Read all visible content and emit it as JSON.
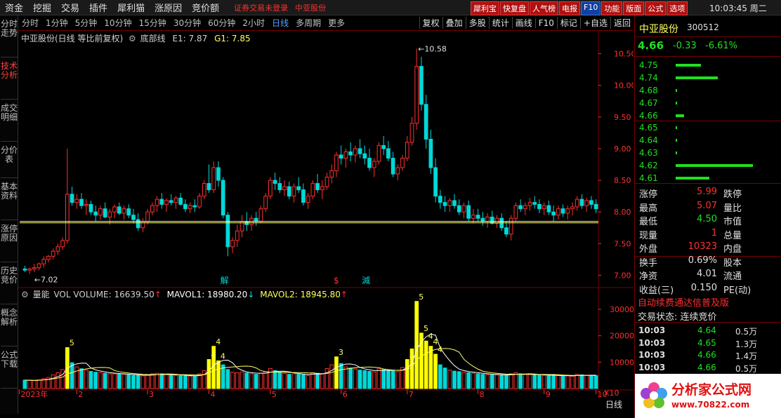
{
  "menu": [
    "资金",
    "挖掘",
    "交易",
    "插件",
    "犀利猫",
    "涨原因",
    "竞价额"
  ],
  "alert_login": "证券交易未登录",
  "alert_stock": "中亚股份",
  "top_buttons": [
    "犀利宝",
    "快复盘",
    "人气榜",
    "电报",
    "F10",
    "功能",
    "版面",
    "公式",
    "选项"
  ],
  "clock": "10:03:45 周二",
  "side_tabs": [
    "分时走势",
    "技术分析",
    "成交明细",
    "分价表",
    "基本资料",
    "涨停原因",
    "历史竞价",
    "概念解析",
    "公式下载"
  ],
  "periods": [
    "分时",
    "1分钟",
    "5分钟",
    "10分钟",
    "15分钟",
    "30分钟",
    "60分钟",
    "2小时",
    "日线",
    "多周期",
    "更多"
  ],
  "tools": [
    "复权",
    "叠加",
    "多股",
    "统计",
    "画线",
    "F10",
    "标记",
    "+自选",
    "返回"
  ],
  "chart_header": {
    "title": "中亚股份(日线 等比前复权)",
    "indicator": "底部线",
    "e1": "E1: 7.87",
    "g1": "G1: 7.85"
  },
  "volume_header": {
    "name": "量能",
    "vol": "VOL VOLUME: 16639.50",
    "mavol1": "MAVOL1: 18980.20",
    "mavol2": "MAVOL2: 18945.80"
  },
  "annotations": {
    "low": "7.02",
    "high": "10.58",
    "marks": [
      "解",
      "$",
      "減"
    ]
  },
  "stock": {
    "name": "中亚股份",
    "code": "300512",
    "price": "4.66",
    "change": "-0.33",
    "pct": "-6.61%"
  },
  "orderbook": [
    {
      "price": "4.75",
      "size": 0.18
    },
    {
      "price": "4.74",
      "size": 0.3
    },
    {
      "price": "4.68",
      "size": 0.01
    },
    {
      "price": "4.67",
      "size": 0.01
    },
    {
      "price": "4.66",
      "size": 0.06
    },
    {
      "price": "4.65",
      "size": 0.01
    },
    {
      "price": "4.64",
      "size": 0.01
    },
    {
      "price": "4.63",
      "size": 0.01
    },
    {
      "price": "4.62",
      "size": 0.55
    },
    {
      "price": "4.61",
      "size": 0.24
    }
  ],
  "stats": [
    {
      "l": "涨停",
      "v": "5.99",
      "r": "跌停",
      "color": "red"
    },
    {
      "l": "最高",
      "v": "5.07",
      "r": "量比",
      "color": "red"
    },
    {
      "l": "最低",
      "v": "4.50",
      "r": "市值",
      "color": "green"
    },
    {
      "l": "现量",
      "v": "1",
      "r": "总量",
      "color": "red"
    },
    {
      "l": "外盘",
      "v": "10323",
      "r": "内盘",
      "color": "red"
    },
    {
      "l": "换手",
      "v": "0.69%",
      "r": "股本",
      "color": "white"
    },
    {
      "l": "净资",
      "v": "4.01",
      "r": "流通",
      "color": "white"
    },
    {
      "l": "收益(三)",
      "v": "0.150",
      "r": "PE(动)",
      "color": "white"
    }
  ],
  "ad_text": "自动续费通达信普及版",
  "trade_state": "交易状态: 连续竞价",
  "trades": [
    {
      "t": "10:03",
      "p": "4.64",
      "v": "0.5万"
    },
    {
      "t": "10:03",
      "p": "4.65",
      "v": "1.3万"
    },
    {
      "t": "10:03",
      "p": "4.66",
      "v": "1.4万"
    },
    {
      "t": "10:03",
      "p": "4.66",
      "v": "0.5万"
    }
  ],
  "logo": {
    "name": "分析家公式网",
    "url": "www.70822.com"
  },
  "bottom_label": "日线",
  "x_labels": [
    "2023年",
    "2",
    "3",
    "4",
    "5",
    "6",
    "7",
    "8",
    "9",
    "10"
  ],
  "price_ticks": [
    "10.50",
    "10.00",
    "9.50",
    "9.00",
    "8.50",
    "8.00",
    "7.50",
    "7.00"
  ],
  "vol_ticks": [
    "30000",
    "20000",
    "10000"
  ],
  "vol_scale": "X10",
  "chart_data": {
    "type": "candlestick",
    "ylim": [
      6.85,
      10.75
    ],
    "avg_line": 7.85,
    "vol_ylim": [
      0,
      34000
    ],
    "vol_signals": [
      "5",
      "4",
      "4",
      "4",
      "3",
      "3",
      "3",
      "5"
    ],
    "candles": [
      [
        7.1,
        7.15,
        7.05,
        7.08,
        3200
      ],
      [
        7.08,
        7.12,
        7.02,
        7.1,
        3100
      ],
      [
        7.1,
        7.18,
        7.05,
        7.12,
        3000
      ],
      [
        7.12,
        7.2,
        7.08,
        7.18,
        3300
      ],
      [
        7.18,
        7.3,
        7.12,
        7.25,
        3800
      ],
      [
        7.25,
        7.32,
        7.2,
        7.3,
        4200
      ],
      [
        7.3,
        7.42,
        7.25,
        7.38,
        5200
      ],
      [
        7.38,
        7.5,
        7.32,
        7.45,
        6000
      ],
      [
        7.45,
        7.6,
        7.4,
        7.55,
        7200
      ],
      [
        7.55,
        9.0,
        7.5,
        8.28,
        15500
      ],
      [
        8.28,
        8.4,
        8.1,
        8.15,
        9800
      ],
      [
        8.15,
        8.28,
        8.05,
        8.2,
        8200
      ],
      [
        8.2,
        8.3,
        8.05,
        8.1,
        7500
      ],
      [
        8.1,
        8.2,
        7.95,
        8.12,
        7000
      ],
      [
        8.12,
        8.18,
        7.95,
        8.0,
        6500
      ],
      [
        8.0,
        8.1,
        7.85,
        7.95,
        6200
      ],
      [
        7.95,
        8.1,
        7.88,
        8.05,
        6000
      ],
      [
        8.05,
        8.15,
        7.9,
        7.92,
        5800
      ],
      [
        7.92,
        8.05,
        7.8,
        8.0,
        5600
      ],
      [
        8.0,
        8.12,
        7.9,
        8.08,
        5600
      ],
      [
        8.08,
        8.15,
        7.95,
        7.98,
        5500
      ],
      [
        7.98,
        8.1,
        7.88,
        8.05,
        5400
      ],
      [
        8.05,
        8.12,
        7.9,
        7.95,
        5200
      ],
      [
        7.95,
        8.05,
        7.82,
        7.88,
        5000
      ],
      [
        7.88,
        7.98,
        7.7,
        7.75,
        5000
      ],
      [
        7.75,
        7.9,
        7.68,
        7.85,
        4800
      ],
      [
        7.85,
        8.05,
        7.8,
        8.0,
        5200
      ],
      [
        8.0,
        8.15,
        7.95,
        8.1,
        5600
      ],
      [
        8.1,
        8.25,
        8.0,
        8.2,
        5800
      ],
      [
        8.2,
        8.3,
        8.05,
        8.12,
        5600
      ],
      [
        8.12,
        8.22,
        8.0,
        8.18,
        5400
      ],
      [
        8.18,
        8.28,
        8.1,
        8.15,
        5200
      ],
      [
        8.15,
        8.25,
        8.05,
        8.22,
        5000
      ],
      [
        8.22,
        8.3,
        8.1,
        8.12,
        4900
      ],
      [
        8.12,
        8.2,
        8.0,
        8.05,
        4800
      ],
      [
        8.05,
        8.15,
        7.98,
        8.1,
        4700
      ],
      [
        8.1,
        8.2,
        8.0,
        8.08,
        4600
      ],
      [
        8.08,
        8.3,
        8.05,
        8.25,
        5600
      ],
      [
        8.25,
        8.5,
        8.2,
        8.45,
        6800
      ],
      [
        8.45,
        8.75,
        8.3,
        8.35,
        11000
      ],
      [
        8.35,
        8.8,
        8.3,
        8.7,
        16000
      ],
      [
        8.7,
        8.8,
        8.4,
        8.5,
        10500
      ],
      [
        8.5,
        8.55,
        7.9,
        7.95,
        9000
      ],
      [
        7.95,
        8.0,
        7.3,
        7.45,
        7200
      ],
      [
        7.45,
        7.6,
        7.35,
        7.55,
        6200
      ],
      [
        7.55,
        7.8,
        7.45,
        7.7,
        6000
      ],
      [
        7.7,
        7.95,
        7.6,
        7.85,
        6300
      ],
      [
        7.85,
        8.0,
        7.7,
        7.8,
        5900
      ],
      [
        7.8,
        7.95,
        7.7,
        7.9,
        5600
      ],
      [
        7.9,
        8.0,
        7.78,
        7.85,
        5400
      ],
      [
        7.85,
        8.1,
        7.82,
        8.05,
        5800
      ],
      [
        8.05,
        8.3,
        8.0,
        8.25,
        6400
      ],
      [
        8.25,
        8.55,
        8.2,
        8.5,
        7600
      ],
      [
        8.5,
        8.62,
        8.35,
        8.45,
        6800
      ],
      [
        8.45,
        8.55,
        8.3,
        8.35,
        6200
      ],
      [
        8.35,
        8.5,
        8.25,
        8.4,
        5800
      ],
      [
        8.4,
        8.48,
        8.2,
        8.25,
        5400
      ],
      [
        8.25,
        8.45,
        8.15,
        8.4,
        5600
      ],
      [
        8.4,
        8.55,
        8.3,
        8.35,
        5400
      ],
      [
        8.35,
        8.45,
        8.1,
        8.15,
        5200
      ],
      [
        8.15,
        8.3,
        8.05,
        8.25,
        5000
      ],
      [
        8.25,
        8.5,
        8.2,
        8.45,
        6000
      ],
      [
        8.45,
        8.6,
        8.3,
        8.35,
        5800
      ],
      [
        8.35,
        8.5,
        8.2,
        8.4,
        5600
      ],
      [
        8.4,
        8.62,
        8.35,
        8.55,
        7600
      ],
      [
        8.55,
        8.75,
        8.45,
        8.65,
        9000
      ],
      [
        8.65,
        8.95,
        8.55,
        8.9,
        12000
      ],
      [
        8.9,
        9.05,
        8.75,
        8.85,
        9500
      ],
      [
        8.85,
        9.0,
        8.7,
        8.95,
        8200
      ],
      [
        8.95,
        9.1,
        8.8,
        8.9,
        7800
      ],
      [
        8.9,
        9.05,
        8.78,
        9.0,
        7400
      ],
      [
        9.0,
        9.15,
        8.85,
        8.92,
        7000
      ],
      [
        8.92,
        9.05,
        8.75,
        8.85,
        6800
      ],
      [
        8.85,
        9.0,
        8.65,
        8.7,
        6500
      ],
      [
        8.7,
        8.85,
        8.55,
        8.8,
        6300
      ],
      [
        8.8,
        9.1,
        8.75,
        9.05,
        7500
      ],
      [
        9.05,
        9.2,
        8.9,
        9.0,
        7200
      ],
      [
        9.0,
        9.12,
        8.8,
        8.85,
        6900
      ],
      [
        8.85,
        8.95,
        8.55,
        8.6,
        6600
      ],
      [
        8.6,
        8.75,
        8.5,
        8.7,
        6400
      ],
      [
        8.7,
        8.9,
        8.65,
        8.85,
        8000
      ],
      [
        8.85,
        9.2,
        8.8,
        9.1,
        11000
      ],
      [
        9.1,
        9.5,
        9.05,
        9.4,
        15000
      ],
      [
        9.4,
        10.58,
        9.3,
        10.3,
        33000
      ],
      [
        10.3,
        10.45,
        9.6,
        9.7,
        21000
      ],
      [
        9.7,
        9.85,
        9.0,
        9.15,
        18000
      ],
      [
        9.15,
        9.3,
        8.6,
        8.7,
        16000
      ],
      [
        8.7,
        8.85,
        8.15,
        8.25,
        13000
      ],
      [
        8.25,
        8.35,
        8.05,
        8.15,
        9000
      ],
      [
        8.15,
        8.25,
        8.0,
        8.1,
        7800
      ],
      [
        8.1,
        8.22,
        8.0,
        8.18,
        7000
      ],
      [
        8.18,
        8.28,
        8.05,
        8.1,
        6600
      ],
      [
        8.1,
        8.2,
        7.95,
        8.0,
        6400
      ],
      [
        8.0,
        8.15,
        7.9,
        8.1,
        6200
      ],
      [
        8.1,
        8.18,
        7.85,
        7.9,
        6000
      ],
      [
        7.9,
        8.05,
        7.82,
        7.95,
        5800
      ],
      [
        7.95,
        8.05,
        7.85,
        7.9,
        5600
      ],
      [
        7.9,
        8.0,
        7.78,
        7.85,
        5400
      ],
      [
        7.85,
        7.98,
        7.75,
        7.92,
        5300
      ],
      [
        7.92,
        8.02,
        7.8,
        7.82,
        5200
      ],
      [
        7.82,
        7.95,
        7.75,
        7.9,
        5200
      ],
      [
        7.9,
        7.98,
        7.7,
        7.75,
        5100
      ],
      [
        7.75,
        7.85,
        7.6,
        7.65,
        5000
      ],
      [
        7.65,
        7.95,
        7.55,
        7.9,
        5600
      ],
      [
        7.9,
        8.15,
        7.85,
        8.1,
        6000
      ],
      [
        8.1,
        8.2,
        8.0,
        8.05,
        5600
      ],
      [
        8.05,
        8.15,
        7.95,
        8.1,
        5400
      ],
      [
        8.1,
        8.22,
        8.02,
        8.15,
        5300
      ],
      [
        8.15,
        8.25,
        8.05,
        8.12,
        5200
      ],
      [
        8.12,
        8.2,
        7.98,
        8.05,
        5100
      ],
      [
        8.05,
        8.15,
        7.95,
        8.1,
        5000
      ],
      [
        8.1,
        8.18,
        7.95,
        8.0,
        5000
      ],
      [
        8.0,
        8.1,
        7.85,
        7.95,
        4900
      ],
      [
        7.95,
        8.1,
        7.88,
        8.05,
        4900
      ],
      [
        8.05,
        8.12,
        7.92,
        7.98,
        4800
      ],
      [
        7.98,
        8.1,
        7.88,
        8.05,
        4800
      ],
      [
        8.05,
        8.15,
        7.95,
        8.08,
        4700
      ],
      [
        8.08,
        8.25,
        8.02,
        8.2,
        5400
      ],
      [
        8.2,
        8.28,
        8.05,
        8.1,
        5200
      ],
      [
        8.1,
        8.22,
        8.0,
        8.18,
        5000
      ],
      [
        8.18,
        8.25,
        8.05,
        8.12,
        4900
      ],
      [
        8.12,
        8.2,
        7.98,
        8.05,
        4900
      ]
    ]
  }
}
